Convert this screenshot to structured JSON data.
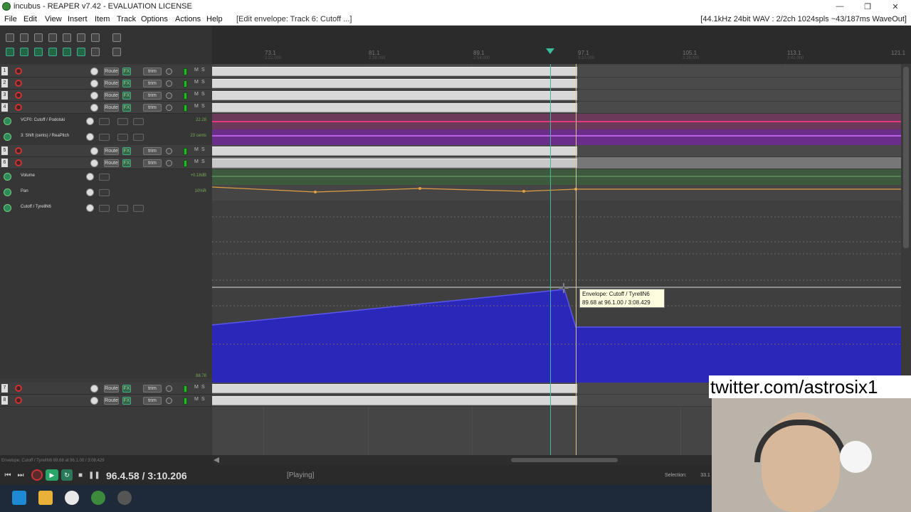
{
  "window": {
    "title": "incubus - REAPER v7.42 - EVALUATION LICENSE"
  },
  "menu": {
    "items": [
      "File",
      "Edit",
      "View",
      "Insert",
      "Item",
      "Track",
      "Options",
      "Actions",
      "Help"
    ],
    "status": "[Edit envelope: Track 6: Cutoff ...]",
    "right": "[44.1kHz 24bit WAV : 2/2ch 1024spls ~43/187ms WaveOut]"
  },
  "ruler": {
    "markers": [
      {
        "bar": "73.1",
        "time": "2:22.000"
      },
      {
        "bar": "81.1",
        "time": "2:38.000"
      },
      {
        "bar": "89.1",
        "time": "2:54.000"
      },
      {
        "bar": "97.1",
        "time": "3:10.000"
      },
      {
        "bar": "105.1",
        "time": "3:26.000"
      },
      {
        "bar": "113.1",
        "time": "3:42.000"
      },
      {
        "bar": "121.1",
        "time": ""
      }
    ]
  },
  "tracks": {
    "t1": {
      "num": "1"
    },
    "t2": {
      "num": "2"
    },
    "t3": {
      "num": "3"
    },
    "t4": {
      "num": "4"
    },
    "t5": {
      "num": "5"
    },
    "t6": {
      "num": "6"
    },
    "t7": {
      "num": "7"
    },
    "t8": {
      "num": "8"
    },
    "route_label": "Route",
    "fx_label": "FX",
    "trim_label": "trim"
  },
  "envelopes": {
    "vcf": {
      "name": "VCF0: Cutoff / Podolski",
      "value": "22.28"
    },
    "shift": {
      "name": "3: Shift (cents) / ReaPitch",
      "value": "23 cents"
    },
    "volume": {
      "name": "Volume",
      "value": "+0.18dB"
    },
    "pan": {
      "name": "Pan",
      "value": "10%R"
    },
    "cutoff": {
      "name": "Cutoff / TyrellN6",
      "value": "88.78"
    }
  },
  "tooltip": {
    "line1": "Envelope: Cutoff / TyrellN6",
    "line2": "89.68 at 96.1.00 / 3:08.429"
  },
  "transport": {
    "time": "96.4.58 / 3:10.206",
    "state": "[Playing]",
    "selection_label": "Selection:",
    "selection_value": "33.1"
  },
  "status": {
    "text": "Envelope: Cutoff / TyrellN6 89.68 at 96.1.00 / 3:08.429"
  },
  "overlay": {
    "twitter": "twitter.com/astrosix1"
  },
  "colors": {
    "accent": "#3dbb9d",
    "envelope": "#2b27b8",
    "record": "#cc3333"
  }
}
